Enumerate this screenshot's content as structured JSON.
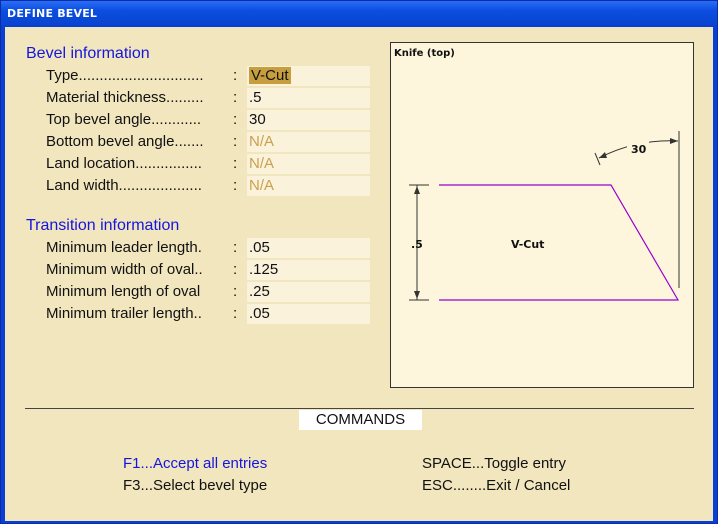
{
  "window": {
    "title": "DEFINE BEVEL"
  },
  "bevel": {
    "heading": "Bevel information",
    "fields": [
      {
        "label": "Type..............................",
        "value": "V-Cut"
      },
      {
        "label": "Material thickness.........",
        "value": ".5"
      },
      {
        "label": "Top bevel angle............",
        "value": "30"
      },
      {
        "label": "Bottom bevel angle.......",
        "value": "N/A"
      },
      {
        "label": "Land location................",
        "value": "N/A"
      },
      {
        "label": "Land width....................",
        "value": "N/A"
      }
    ]
  },
  "transition": {
    "heading": "Transition information",
    "fields": [
      {
        "label": "Minimum leader length.",
        "value": ".05"
      },
      {
        "label": "Minimum width of oval..",
        "value": ".125"
      },
      {
        "label": "Minimum length of oval",
        "value": ".25"
      },
      {
        "label": "Minimum trailer length..",
        "value": ".05"
      }
    ]
  },
  "colon": ":",
  "preview": {
    "title": "Knife (top)",
    "angle_label": "30",
    "thickness_label": ".5",
    "type_label": "V-Cut",
    "line_color": "#9900cc"
  },
  "commands": {
    "title": "COMMANDS",
    "f1": "F1...Accept all entries",
    "f3": "F3...Select bevel type",
    "space": "SPACE...Toggle entry",
    "esc": "ESC........Exit / Cancel"
  }
}
